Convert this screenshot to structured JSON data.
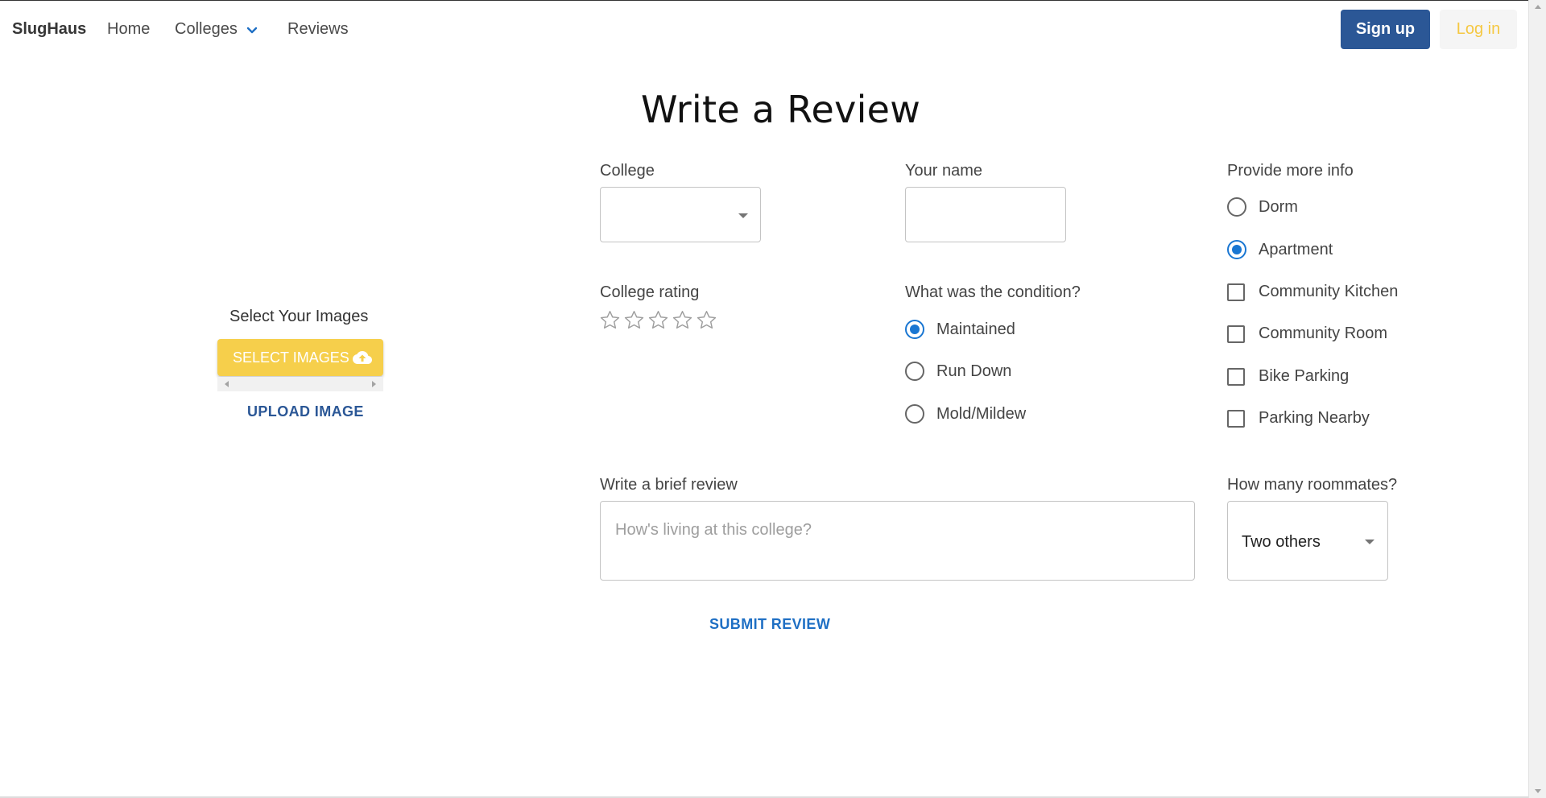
{
  "nav": {
    "brand": "SlugHaus",
    "home": "Home",
    "colleges": "Colleges",
    "reviews": "Reviews",
    "signup": "Sign up",
    "login": "Log in"
  },
  "page_title": "Write a Review",
  "images": {
    "label": "Select Your Images",
    "select_button": "SELECT IMAGES",
    "upload_button": "UPLOAD IMAGE"
  },
  "form": {
    "college_label": "College",
    "college_value": "",
    "name_label": "Your name",
    "name_value": "",
    "rating_label": "College rating",
    "rating_value": 0,
    "rating_max": 5,
    "condition_label": "What was the condition?",
    "condition_options": [
      "Maintained",
      "Run Down",
      "Mold/Mildew"
    ],
    "condition_selected": "Maintained",
    "more_info_label": "Provide more info",
    "housing_options": [
      "Dorm",
      "Apartment"
    ],
    "housing_selected": "Apartment",
    "amenities": [
      "Community Kitchen",
      "Community Room",
      "Bike Parking",
      "Parking Nearby"
    ],
    "review_label": "Write a brief review",
    "review_placeholder": "How's living at this college?",
    "roommates_label": "How many roommates?",
    "roommates_value": "Two others",
    "submit": "SUBMIT REVIEW"
  },
  "colors": {
    "primary": "#2b5796",
    "accent_yellow": "#f6cf4b",
    "radio_blue": "#1976d2"
  }
}
